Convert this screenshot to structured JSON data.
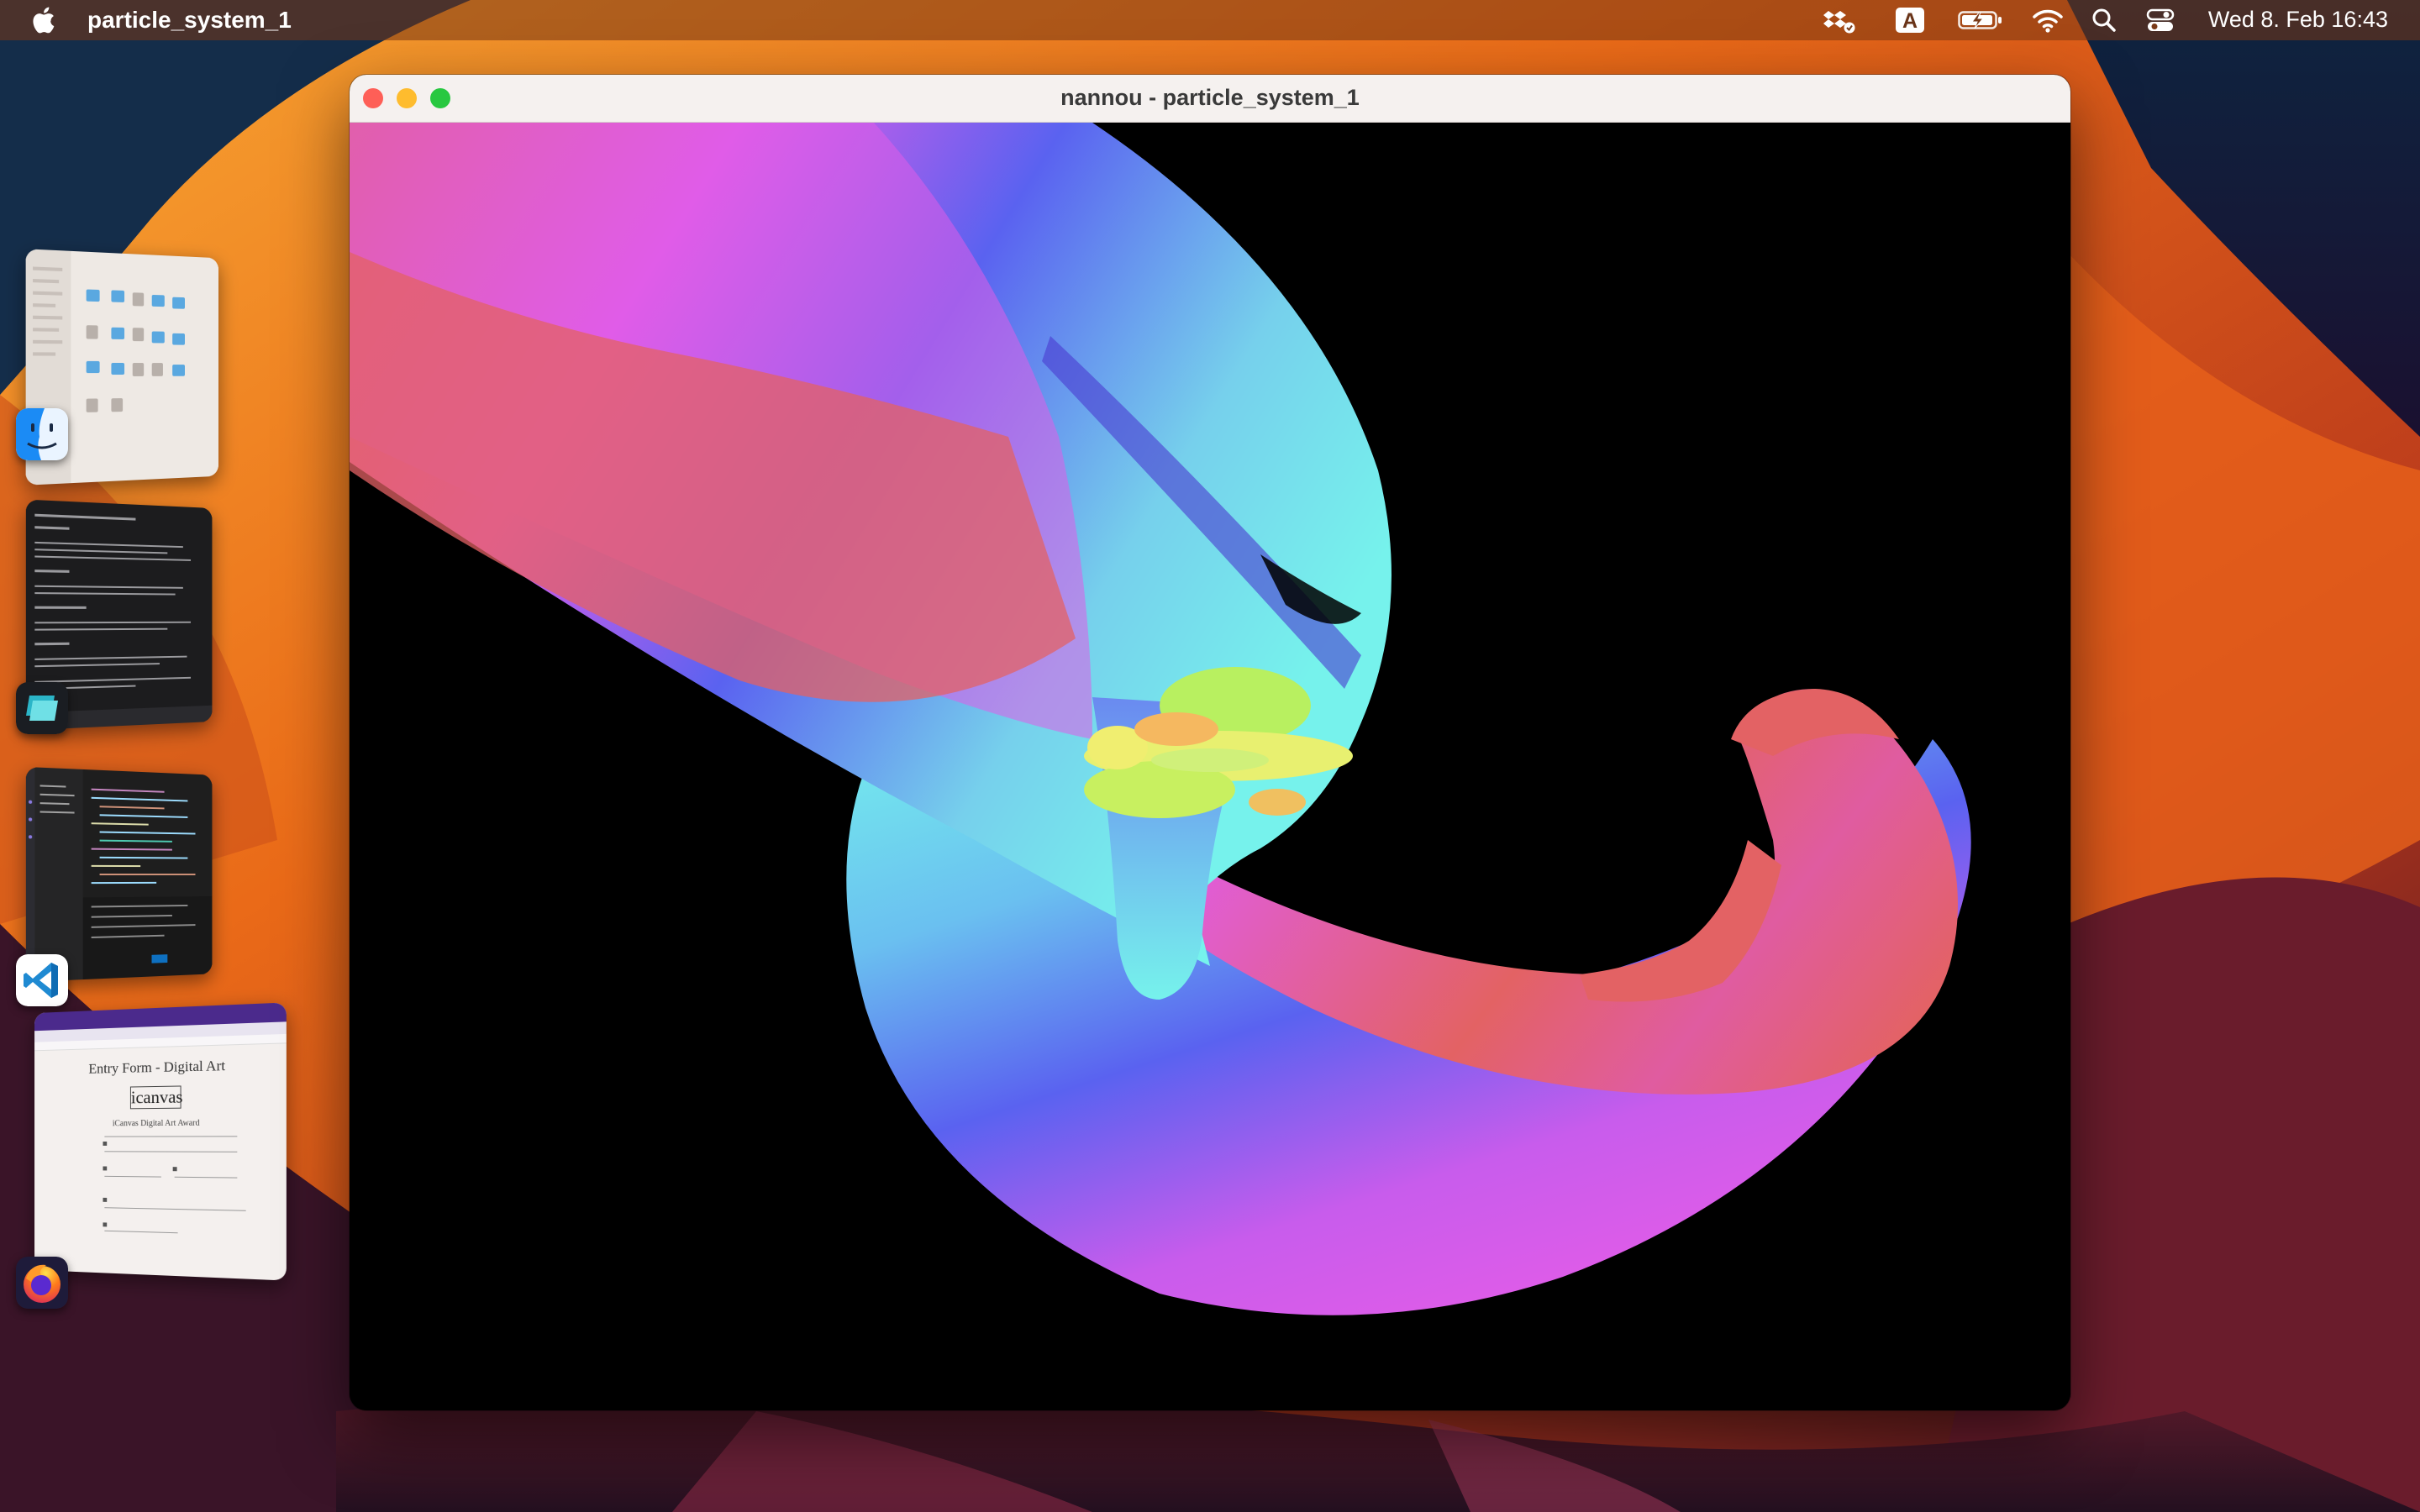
{
  "menubar": {
    "app_name": "particle_system_1",
    "clock": "Wed 8. Feb  16:43",
    "input_source": "A",
    "icons": [
      "apple-icon",
      "dropbox-icon",
      "input-source-icon",
      "battery-charging-icon",
      "wifi-icon",
      "search-icon",
      "control-center-icon"
    ]
  },
  "window": {
    "title": "nannou - particle_system_1",
    "traffic_lights": {
      "close": "#fe5f57",
      "minimize": "#febc2e",
      "zoom": "#28c840"
    }
  },
  "stage_manager": {
    "apps": [
      "Finder",
      "Warp",
      "Visual Studio Code",
      "Firefox"
    ],
    "firefox_preview": {
      "heading": "Entry Form - Digital Art",
      "logo": "icanvas",
      "subheading": "iCanvas Digital Art Award"
    }
  },
  "colors": {
    "pink": "#e05ce8",
    "coral": "#e36264",
    "blue": "#5a62f0",
    "cyan": "#76f2ec",
    "lime": "#b8f060",
    "yellow": "#f0ee70"
  }
}
